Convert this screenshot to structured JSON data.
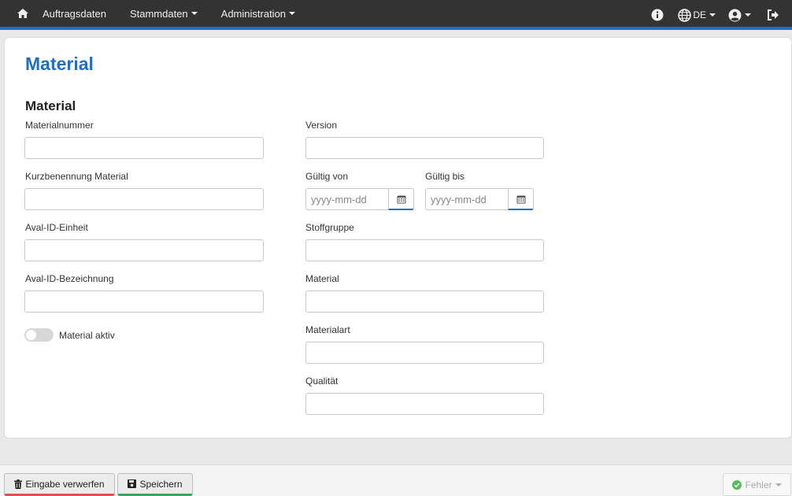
{
  "nav": {
    "home_icon": "home-icon",
    "auftragsdaten": "Auftragsdaten",
    "stammdaten": "Stammdaten",
    "administration": "Administration",
    "language": "DE",
    "icons": [
      "info-icon",
      "globe-icon",
      "user-icon",
      "logout-icon"
    ]
  },
  "page": {
    "title": "Material",
    "section_title": "Material"
  },
  "fields": {
    "materialnummer": {
      "label": "Materialnummer",
      "value": ""
    },
    "kurzbenennung": {
      "label": "Kurzbenennung Material",
      "value": ""
    },
    "aval_einheit": {
      "label": "Aval-ID-Einheit",
      "value": ""
    },
    "aval_bezeichnung": {
      "label": "Aval-ID-Bezeichnung",
      "value": ""
    },
    "material_aktiv": {
      "label": "Material aktiv",
      "checked": false
    },
    "version": {
      "label": "Version",
      "value": ""
    },
    "gueltig_von": {
      "label": "Gültig von",
      "placeholder": "yyyy-mm-dd"
    },
    "gueltig_bis": {
      "label": "Gültig bis",
      "placeholder": "yyyy-mm-dd"
    },
    "stoffgruppe": {
      "label": "Stoffgruppe",
      "value": ""
    },
    "material": {
      "label": "Material",
      "value": ""
    },
    "materialart": {
      "label": "Materialart",
      "value": ""
    },
    "qualitaet": {
      "label": "Qualität",
      "value": ""
    }
  },
  "footer": {
    "discard_label": "Eingabe verwerfen",
    "save_label": "Speichern",
    "error_label": "Fehler"
  },
  "colors": {
    "accent": "#1f6fc4",
    "navbar": "#333333",
    "discard": "#d9534f",
    "save": "#3aa55b",
    "ok": "#5cb85c"
  }
}
